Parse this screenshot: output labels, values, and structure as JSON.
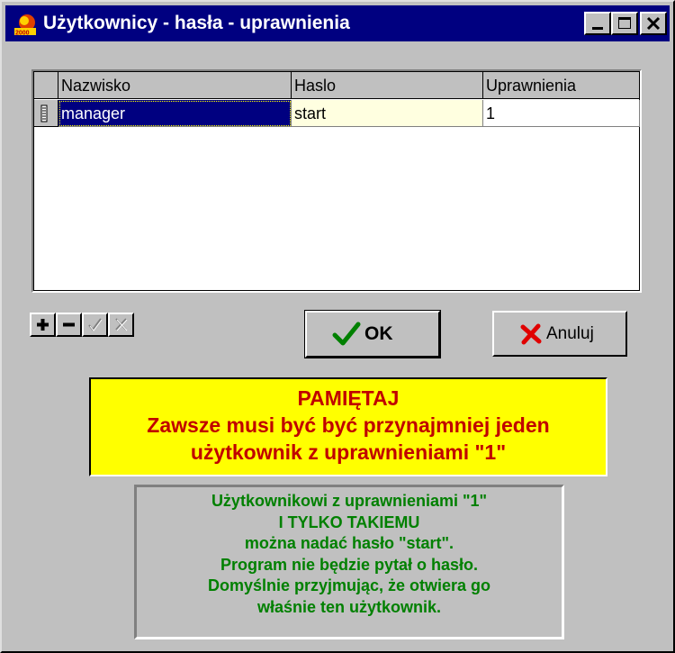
{
  "window": {
    "title": "Użytkownicy - hasła - uprawnienia",
    "buttons": [
      "minimize",
      "maximize",
      "close"
    ]
  },
  "grid": {
    "columns": [
      "Nazwisko",
      "Haslo",
      "Uprawnienia"
    ],
    "rows": [
      {
        "indicator": "edit-indicator",
        "nazwisko": "manager",
        "haslo": "start",
        "uprawnienia": "1"
      }
    ]
  },
  "navigator": {
    "buttons": [
      {
        "name": "insert",
        "icon": "plus-icon",
        "enabled": true
      },
      {
        "name": "delete",
        "icon": "minus-icon",
        "enabled": true
      },
      {
        "name": "post",
        "icon": "check-icon",
        "enabled": false
      },
      {
        "name": "cancel",
        "icon": "x-icon",
        "enabled": false
      }
    ]
  },
  "buttons": {
    "ok_label": "OK",
    "cancel_label": "Anuluj"
  },
  "warning": {
    "lines": [
      "PAMIĘTAJ",
      "Zawsze musi być być przynajmniej jeden",
      "użytkownik z uprawnieniami \"1\""
    ],
    "background": "#ffff00",
    "color": "#c00000"
  },
  "info": {
    "lines": [
      "Użytkownikowi z uprawnieniami \"1\"",
      "I TYLKO TAKIEMU",
      "można nadać hasło \"start\".",
      "Program nie będzie pytał o hasło.",
      "Domyślnie przyjmując, że otwiera go",
      "właśnie ten użytkownik."
    ],
    "color": "#008000"
  },
  "colors": {
    "titlebar": "#000080",
    "face": "#c0c0c0",
    "selection": "#000080",
    "cell_highlight": "#ffffe0"
  }
}
